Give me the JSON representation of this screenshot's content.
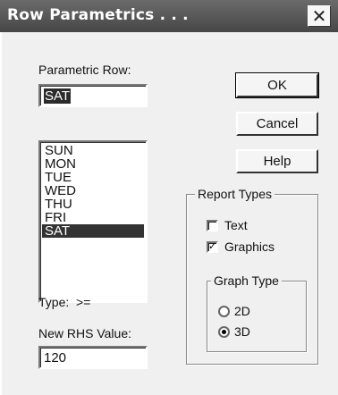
{
  "window": {
    "title": "Row Parametrics . . .",
    "close_glyph": "✕"
  },
  "parametric_row": {
    "label": "Parametric Row:",
    "value": "SAT",
    "options": [
      "SUN",
      "MON",
      "TUE",
      "WED",
      "THU",
      "FRI",
      "SAT"
    ],
    "selected": "SAT"
  },
  "type_line": {
    "label": "Type:",
    "value": ">="
  },
  "rhs": {
    "label": "New RHS Value:",
    "value": "120"
  },
  "buttons": {
    "ok": "OK",
    "cancel": "Cancel",
    "help": "Help"
  },
  "report_types": {
    "title": "Report Types",
    "text": {
      "label": "Text",
      "checked": false
    },
    "graphics": {
      "label": "Graphics",
      "checked": true,
      "mark": "✓"
    }
  },
  "graph_type": {
    "title": "Graph Type",
    "options": [
      {
        "label": "2D",
        "selected": false
      },
      {
        "label": "3D",
        "selected": true
      }
    ]
  }
}
